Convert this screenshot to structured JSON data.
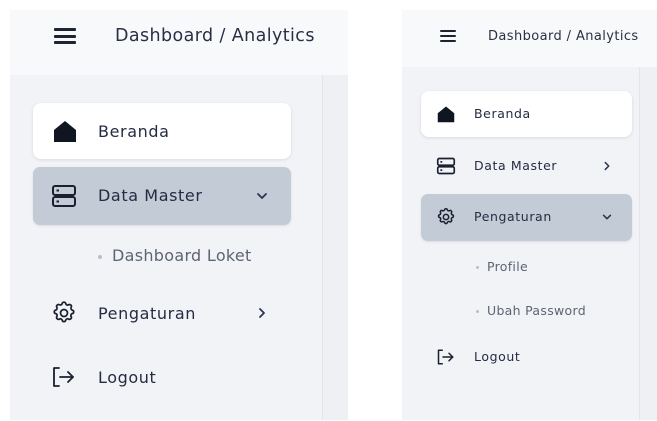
{
  "left": {
    "breadcrumb": "Dashboard / Analytics",
    "menu": [
      {
        "label": "Beranda",
        "icon": "home-icon"
      },
      {
        "label": "Data Master",
        "icon": "server-icon",
        "chevron": "chevron-down-icon"
      },
      {
        "label": "Pengaturan",
        "icon": "gear-icon",
        "chevron": "chevron-right-icon"
      },
      {
        "label": "Logout",
        "icon": "logout-icon"
      }
    ],
    "submenu": [
      "Dashboard Loket"
    ]
  },
  "right": {
    "breadcrumb": "Dashboard / Analytics",
    "menu": [
      {
        "label": "Beranda",
        "icon": "home-icon"
      },
      {
        "label": "Data Master",
        "icon": "server-icon",
        "chevron": "chevron-right-icon"
      },
      {
        "label": "Pengaturan",
        "icon": "gear-icon",
        "chevron": "chevron-down-icon"
      },
      {
        "label": "Logout",
        "icon": "logout-icon"
      }
    ],
    "submenu": [
      "Profile",
      "Ubah Password"
    ]
  },
  "colors": {
    "active_gray": "#c3cbd6",
    "active_white": "#ffffff",
    "sidebar_bg": "#f1f3f6",
    "text": "#262b42",
    "icon_dark": "#0f1622"
  }
}
